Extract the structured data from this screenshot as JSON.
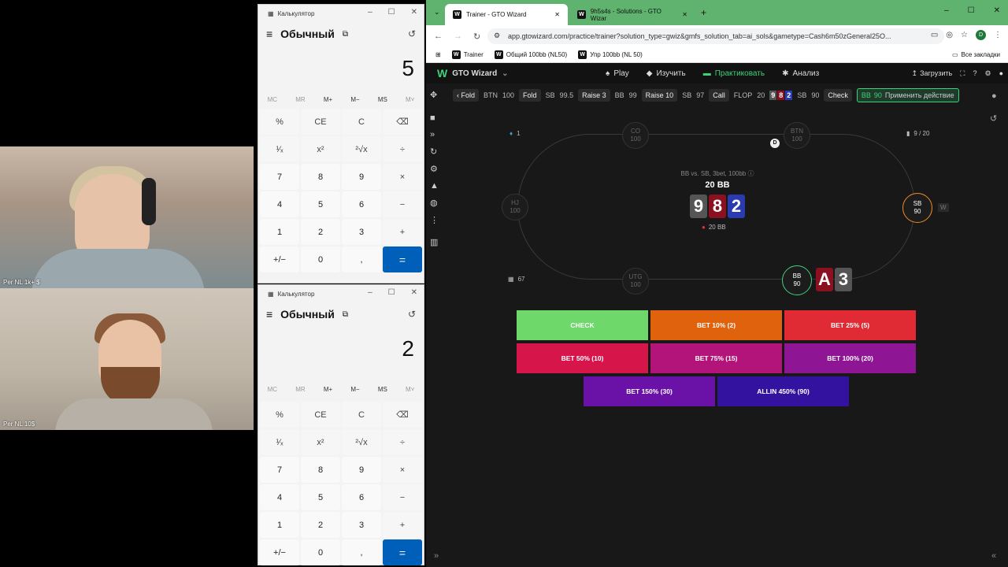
{
  "cams": {
    "top_label": "Per NL 1k+ $",
    "bottom_label": "Per NL 10$"
  },
  "calc1": {
    "title": "Калькулятор",
    "mode": "Обычный",
    "display": "5"
  },
  "calc2": {
    "title": "Калькулятор",
    "mode": "Обычный",
    "display": "2"
  },
  "calc_memory": [
    "MC",
    "MR",
    "M+",
    "M−",
    "MS",
    "M˅"
  ],
  "calc_keys": [
    "%",
    "CE",
    "C",
    "⌫",
    "¹⁄ₓ",
    "x²",
    "²√x",
    "÷",
    "7",
    "8",
    "9",
    "×",
    "4",
    "5",
    "6",
    "−",
    "1",
    "2",
    "3",
    "+",
    "+/−",
    "0",
    ",",
    "="
  ],
  "browser": {
    "tabs": [
      {
        "label": "Trainer - GTO Wizard"
      },
      {
        "label": "9h5s4s - Solutions - GTO Wizar"
      }
    ],
    "url": "app.gtowizard.com/practice/trainer?solution_type=gwiz&gmfs_solution_tab=ai_sols&gametype=Cash6m50zGeneral25O...",
    "profile_initial": "D",
    "bookmarks": [
      "Trainer",
      "Общий 100bb (NL50)",
      "Упр 100bb (NL 50)"
    ],
    "bookmarks_all": "Все закладки"
  },
  "app": {
    "brand": "GTO Wizard",
    "nav": [
      "Play",
      "Изучить",
      "Практиковать",
      "Анализ"
    ],
    "upload": "Загрузить"
  },
  "action_bar": {
    "back": "Fold",
    "items": [
      {
        "pos": "BTN",
        "stack": "100",
        "action": "Fold"
      },
      {
        "pos": "SB",
        "stack": "99.5",
        "action": "Raise 3"
      },
      {
        "pos": "BB",
        "stack": "99",
        "action": "Raise 10"
      },
      {
        "pos": "SB",
        "stack": "97",
        "action": "Call"
      }
    ],
    "flop_label": "FLOP",
    "flop_pot": "20",
    "after": {
      "pos": "SB",
      "stack": "90",
      "action": "Check"
    },
    "current": {
      "pos": "BB",
      "stack": "90",
      "action": "Применить действие"
    }
  },
  "table": {
    "hands_label": "1",
    "progress": "9 / 20",
    "chips_count": "67",
    "scenario": "BB vs. SB, 3bet, 100bb",
    "pot": "20 BB",
    "pot_bottom": "20 BB",
    "board": [
      {
        "rank": "9",
        "color": "#555555"
      },
      {
        "rank": "8",
        "color": "#8b1020"
      },
      {
        "rank": "2",
        "color": "#2a3bb0"
      }
    ],
    "hero_cards": [
      {
        "rank": "A",
        "color": "#8b1020"
      },
      {
        "rank": "3",
        "color": "#555555"
      }
    ],
    "seats": {
      "co": {
        "name": "CO",
        "stack": "100"
      },
      "btn": {
        "name": "BTN",
        "stack": "100"
      },
      "hj": {
        "name": "HJ",
        "stack": "100"
      },
      "sb": {
        "name": "SB",
        "stack": "90"
      },
      "utg": {
        "name": "UTG",
        "stack": "100"
      },
      "bb": {
        "name": "BB",
        "stack": "90"
      }
    },
    "dealer": "D",
    "sb_badge": "W"
  },
  "actions": [
    {
      "label": "CHECK",
      "color": "#6fd86a"
    },
    {
      "label": "BET 10% (2)",
      "color": "#e0620c"
    },
    {
      "label": "BET 25% (5)",
      "color": "#e02a34"
    },
    {
      "label": "BET 50% (10)",
      "color": "#d6164a"
    },
    {
      "label": "BET 75% (15)",
      "color": "#b3147a"
    },
    {
      "label": "BET 100% (20)",
      "color": "#8e1694"
    },
    {
      "label": "BET 150% (30)",
      "color": "#6a12a8"
    },
    {
      "label": "ALLIN 450% (90)",
      "color": "#3412a0"
    }
  ]
}
